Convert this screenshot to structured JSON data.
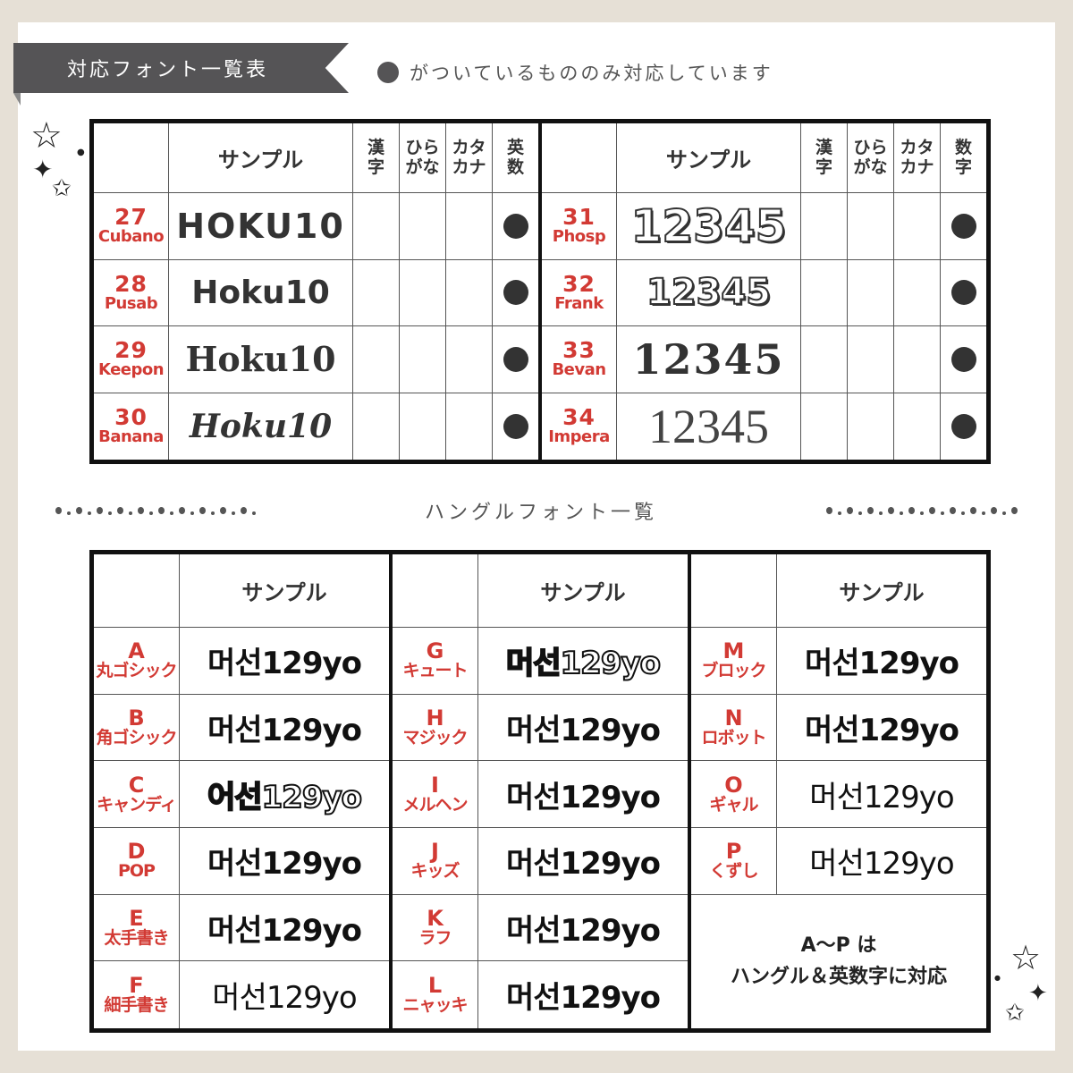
{
  "header": {
    "title": "対応フォント一覧表",
    "legend_text": "がついているもののみ対応しています"
  },
  "top_table": {
    "headers": {
      "sample": "サンプル",
      "kanji": [
        "漢",
        "字"
      ],
      "hiragana": [
        "ひら",
        "がな"
      ],
      "katakana": [
        "カタ",
        "カナ"
      ],
      "alnum_left": [
        "英",
        "数"
      ],
      "alnum_right": [
        "数",
        "字"
      ]
    },
    "left_rows": [
      {
        "num": "27",
        "name": "Cubano",
        "sample": "HOKU10",
        "kanji": false,
        "hiragana": false,
        "katakana": false,
        "alnum": true
      },
      {
        "num": "28",
        "name": "Pusab",
        "sample": "Hoku10",
        "kanji": false,
        "hiragana": false,
        "katakana": false,
        "alnum": true
      },
      {
        "num": "29",
        "name": "Keepon",
        "sample": "Hoku10",
        "kanji": false,
        "hiragana": false,
        "katakana": false,
        "alnum": true
      },
      {
        "num": "30",
        "name": "Banana",
        "sample": "Hoku10",
        "kanji": false,
        "hiragana": false,
        "katakana": false,
        "alnum": true
      }
    ],
    "right_rows": [
      {
        "num": "31",
        "name": "Phosp",
        "sample": "12345",
        "kanji": false,
        "hiragana": false,
        "katakana": false,
        "alnum": true
      },
      {
        "num": "32",
        "name": "Frank",
        "sample": "12345",
        "kanji": false,
        "hiragana": false,
        "katakana": false,
        "alnum": true
      },
      {
        "num": "33",
        "name": "Bevan",
        "sample": "12345",
        "kanji": false,
        "hiragana": false,
        "katakana": false,
        "alnum": true
      },
      {
        "num": "34",
        "name": "Impera",
        "sample": "12345",
        "kanji": false,
        "hiragana": false,
        "katakana": false,
        "alnum": true
      }
    ]
  },
  "divider": {
    "title": "ハングルフォント一覧"
  },
  "bottom_table": {
    "sample_header": "サンプル",
    "sections": [
      {
        "rows": [
          {
            "letter": "A",
            "name": "丸ゴシック",
            "sample": "머선129yo"
          },
          {
            "letter": "B",
            "name": "角ゴシック",
            "sample": "머선129yo"
          },
          {
            "letter": "C",
            "name": "キャンディ",
            "sample": "어선129yo"
          },
          {
            "letter": "D",
            "name": "POP",
            "sample": "머선129yo"
          },
          {
            "letter": "E",
            "name": "太手書き",
            "sample": "머선129yo"
          },
          {
            "letter": "F",
            "name": "細手書き",
            "sample": "머선129yo"
          }
        ]
      },
      {
        "rows": [
          {
            "letter": "G",
            "name": "キュート",
            "sample": "머선129yo"
          },
          {
            "letter": "H",
            "name": "マジック",
            "sample": "머선129yo"
          },
          {
            "letter": "I",
            "name": "メルヘン",
            "sample": "머선129yo"
          },
          {
            "letter": "J",
            "name": "キッズ",
            "sample": "머선129yo"
          },
          {
            "letter": "K",
            "name": "ラフ",
            "sample": "머선129yo"
          },
          {
            "letter": "L",
            "name": "ニャッキ",
            "sample": "머선129yo"
          }
        ]
      },
      {
        "rows": [
          {
            "letter": "M",
            "name": "ブロック",
            "sample": "머선129yo"
          },
          {
            "letter": "N",
            "name": "ロボット",
            "sample": "머선129yo"
          },
          {
            "letter": "O",
            "name": "ギャル",
            "sample": "머선129yo"
          },
          {
            "letter": "P",
            "name": "くずし",
            "sample": "머선129yo"
          }
        ]
      }
    ],
    "note_line1": "A～P は",
    "note_line2": "ハングル＆英数字に対応"
  },
  "colors": {
    "accent_red": "#d23a34",
    "ribbon": "#555456",
    "background": "#e6e0d6"
  }
}
